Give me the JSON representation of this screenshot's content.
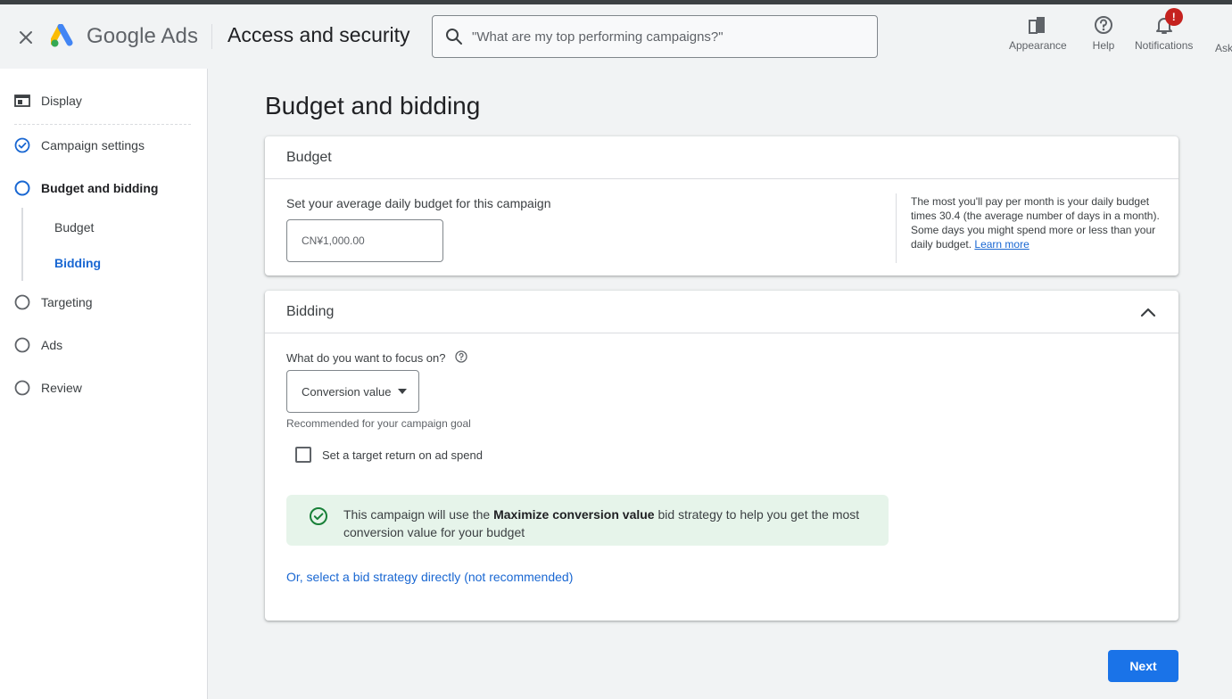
{
  "app": {
    "close_icon": "close-icon",
    "logo_text": "Google Ads",
    "section_title": "Access and security",
    "brand_colors": {
      "blue": "#4285F4",
      "yellow": "#FBBC04",
      "green": "#34A853"
    }
  },
  "search": {
    "placeholder": "\"What are my top performing campaigns?\"",
    "icon": "search-icon"
  },
  "header_actions": [
    {
      "label": "Appearance",
      "icon": "appearance-icon"
    },
    {
      "label": "Help",
      "icon": "help-icon"
    },
    {
      "label": "Notifications",
      "icon": "bell-icon",
      "badge": "!"
    },
    {
      "label": "Ask",
      "icon": "ask-icon"
    }
  ],
  "sidebar": {
    "items": [
      {
        "label": "Display",
        "icon": "display-icon",
        "status": "type"
      },
      {
        "label": "Campaign settings",
        "icon": "check-circle-icon",
        "status": "done"
      },
      {
        "label": "Budget and bidding",
        "icon": "circle-icon",
        "status": "current"
      },
      {
        "label": "Targeting",
        "icon": "circle-icon",
        "status": "todo"
      },
      {
        "label": "Ads",
        "icon": "circle-icon",
        "status": "todo"
      },
      {
        "label": "Review",
        "icon": "circle-icon",
        "status": "todo"
      }
    ],
    "sub_items": [
      {
        "label": "Budget",
        "active": false
      },
      {
        "label": "Bidding",
        "active": true
      }
    ]
  },
  "main": {
    "title": "Budget and bidding",
    "budget": {
      "header": "Budget",
      "label": "Set your average daily budget for this campaign",
      "value": "CN¥1,000.00",
      "help_text": "The most you'll pay per month is your daily budget times 30.4 (the average number of days in a month). Some days you might spend more or less than your daily budget. ",
      "learn_more": "Learn more"
    },
    "bidding": {
      "header": "Bidding",
      "focus_label": "What do you want to focus on?",
      "focus_value": "Conversion value",
      "recommended": "Recommended for your campaign goal",
      "checkbox_label": "Set a target return on ad spend",
      "checkbox_checked": false,
      "info_prefix": "This campaign will use the ",
      "info_bold": "Maximize conversion value",
      "info_suffix": " bid strategy to help you get the most conversion value for your budget",
      "alt_link": "Or, select a bid strategy directly (not recommended)"
    },
    "next_label": "Next"
  },
  "colors": {
    "accent": "#1a73e8",
    "link": "#1967d2",
    "success_bg": "#e6f4ea",
    "success_icon": "#188038",
    "badge": "#c5221f"
  }
}
